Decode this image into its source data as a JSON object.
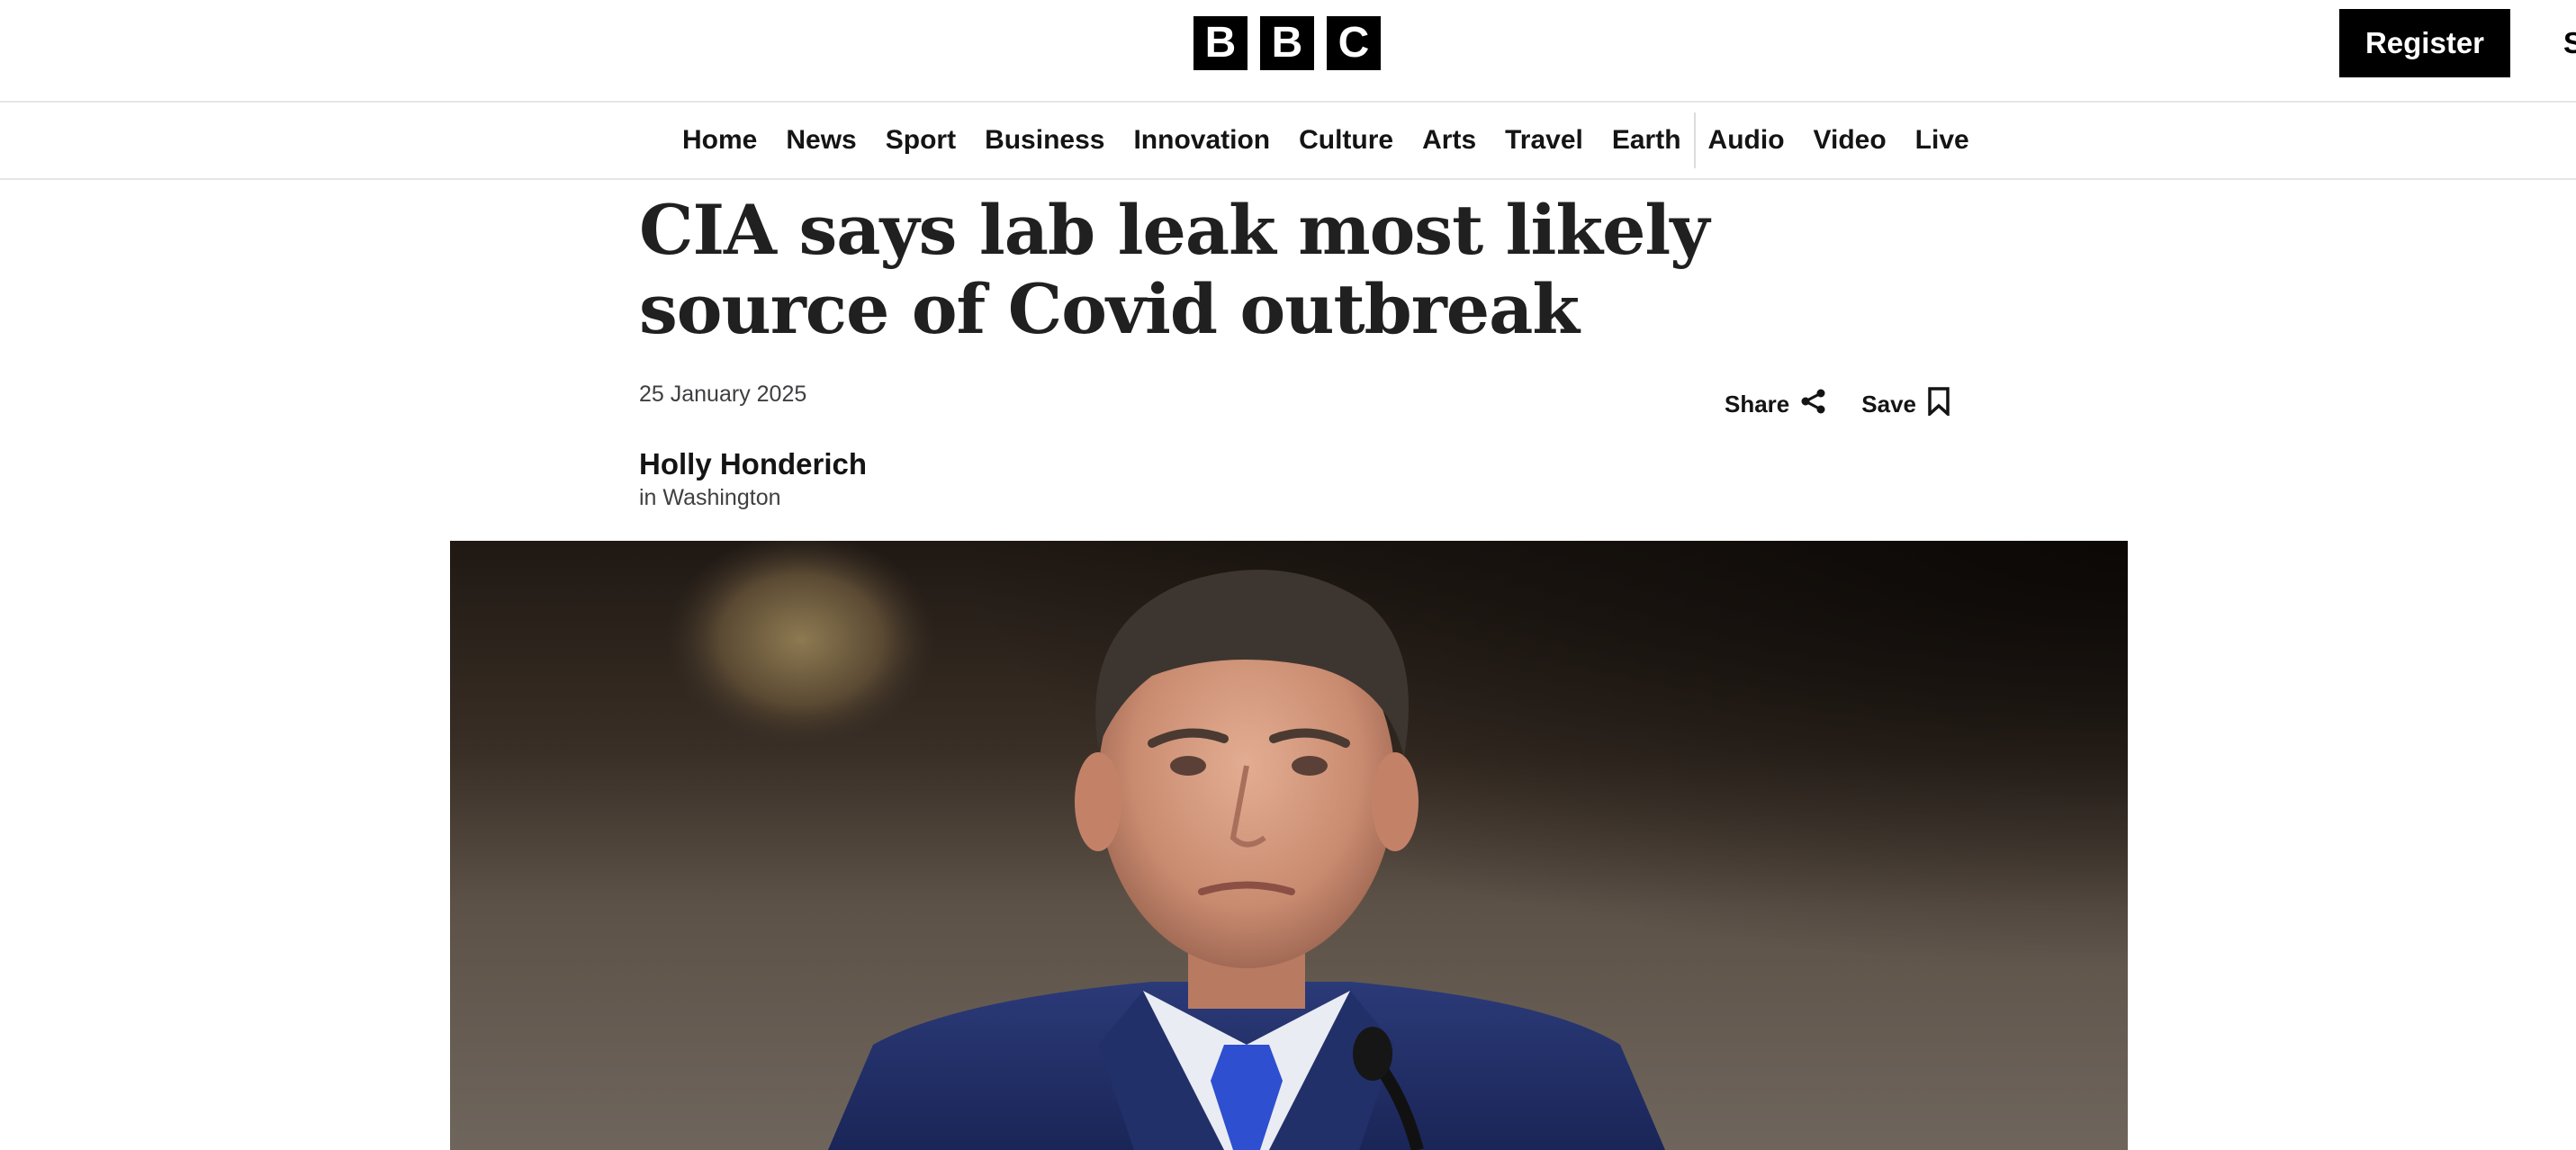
{
  "header": {
    "logo": [
      "B",
      "B",
      "C"
    ],
    "register_label": "Register",
    "signin_label": "Sign In"
  },
  "nav": {
    "items": [
      "Home",
      "News",
      "Sport",
      "Business",
      "Innovation",
      "Culture",
      "Arts",
      "Travel",
      "Earth"
    ],
    "items_right": [
      "Audio",
      "Video",
      "Live"
    ]
  },
  "article": {
    "headline": "CIA says lab leak most likely source of Covid outbreak",
    "date": "25 January 2025",
    "share_label": "Share",
    "save_label": "Save",
    "author": "Holly Honderich",
    "location": "in Washington"
  },
  "icons": {
    "share": "share-icon",
    "save": "bookmark-icon"
  },
  "hero_image": {
    "subject": "man-in-blue-suit-at-microphone"
  }
}
